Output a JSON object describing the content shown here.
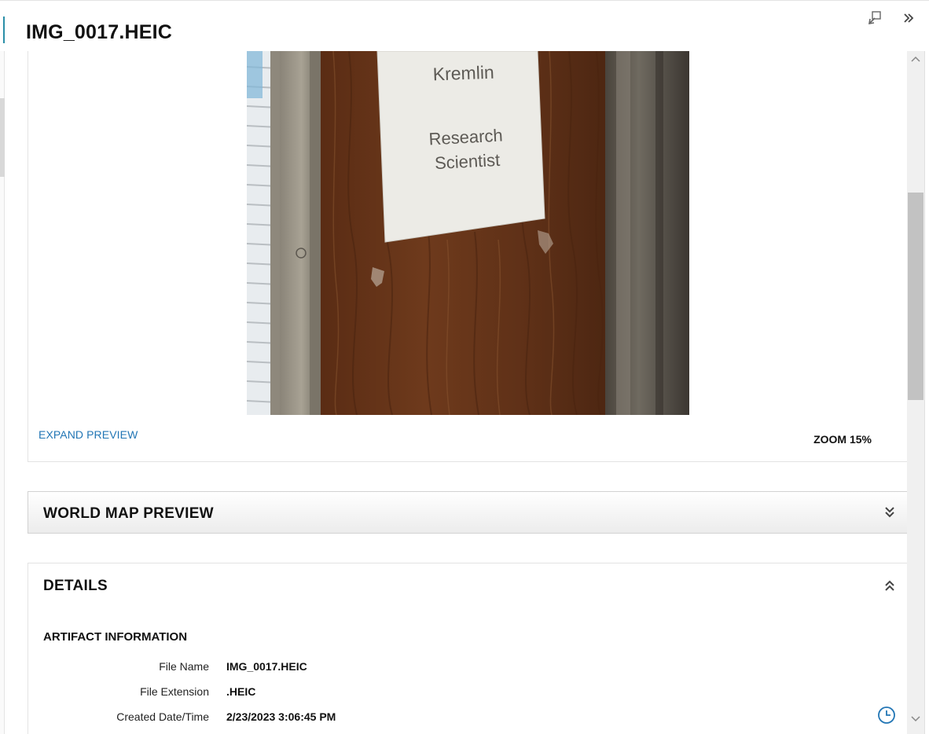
{
  "header": {
    "title": "IMG_0017.HEIC",
    "popout_icon": "popout-window-icon",
    "collapse_icon": "double-chevron-right-icon"
  },
  "preview": {
    "photo_text_line1": "Kremlin",
    "photo_text_line2": "Research",
    "photo_text_line3": "Scientist",
    "expand_label": "EXPAND PREVIEW",
    "zoom_label": "ZOOM 15%"
  },
  "world_map": {
    "title": "WORLD MAP PREVIEW",
    "toggle_icon": "double-chevron-down-icon"
  },
  "details": {
    "title": "DETAILS",
    "toggle_icon": "double-chevron-up-icon",
    "section_title": "ARTIFACT INFORMATION",
    "rows": [
      {
        "label": "File Name",
        "value": "IMG_0017.HEIC"
      },
      {
        "label": "File Extension",
        "value": ".HEIC"
      },
      {
        "label": "Created Date/Time",
        "value": "2/23/2023 3:06:45 PM"
      }
    ]
  },
  "colors": {
    "accent": "#2a8fa8",
    "link": "#2276b5",
    "clock": "#2276b5"
  }
}
